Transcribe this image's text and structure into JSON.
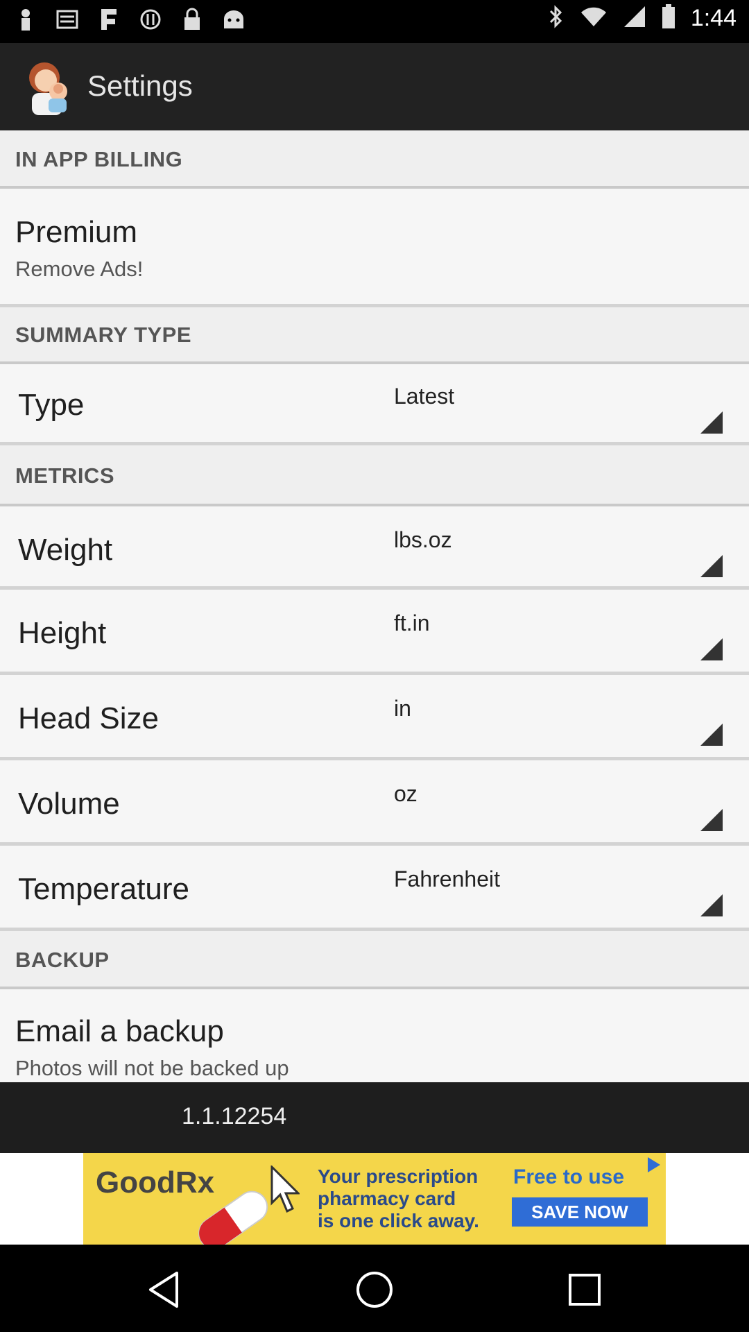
{
  "status_bar": {
    "time": "1:44",
    "left_icons": [
      "person-icon",
      "inbox-icon",
      "flash-icon",
      "sync-icon",
      "lock-icon",
      "android-icon"
    ],
    "right_icons": [
      "bluetooth-icon",
      "wifi-icon",
      "signal-icon",
      "battery-icon"
    ]
  },
  "action_bar": {
    "title": "Settings"
  },
  "sections": {
    "billing": {
      "header": "IN APP BILLING",
      "premium_title": "Premium",
      "premium_summary": "Remove Ads!"
    },
    "summary": {
      "header": "SUMMARY TYPE",
      "type_label": "Type",
      "type_value": "Latest"
    },
    "metrics": {
      "header": "METRICS",
      "items": [
        {
          "label": "Weight",
          "value": "lbs.oz"
        },
        {
          "label": "Height",
          "value": "ft.in"
        },
        {
          "label": "Head Size",
          "value": "in"
        },
        {
          "label": "Volume",
          "value": "oz"
        },
        {
          "label": "Temperature",
          "value": "Fahrenheit"
        }
      ]
    },
    "backup": {
      "header": "BACKUP",
      "email_title": "Email a backup",
      "email_summary": "Photos will not be backed up"
    }
  },
  "version": "1.1.12254",
  "ad": {
    "brand": "GoodRx",
    "line1": "Your prescription",
    "line2": "pharmacy card",
    "line3": "is one click away.",
    "free_text": "Free to use",
    "cta": "SAVE NOW",
    "background": "#f4d64a",
    "accent": "#2f6dd6"
  },
  "nav": {
    "back": "back-icon",
    "home": "home-icon",
    "recents": "recents-icon"
  },
  "colors": {
    "action_bar": "#222222",
    "content": "#f3f3f3"
  }
}
